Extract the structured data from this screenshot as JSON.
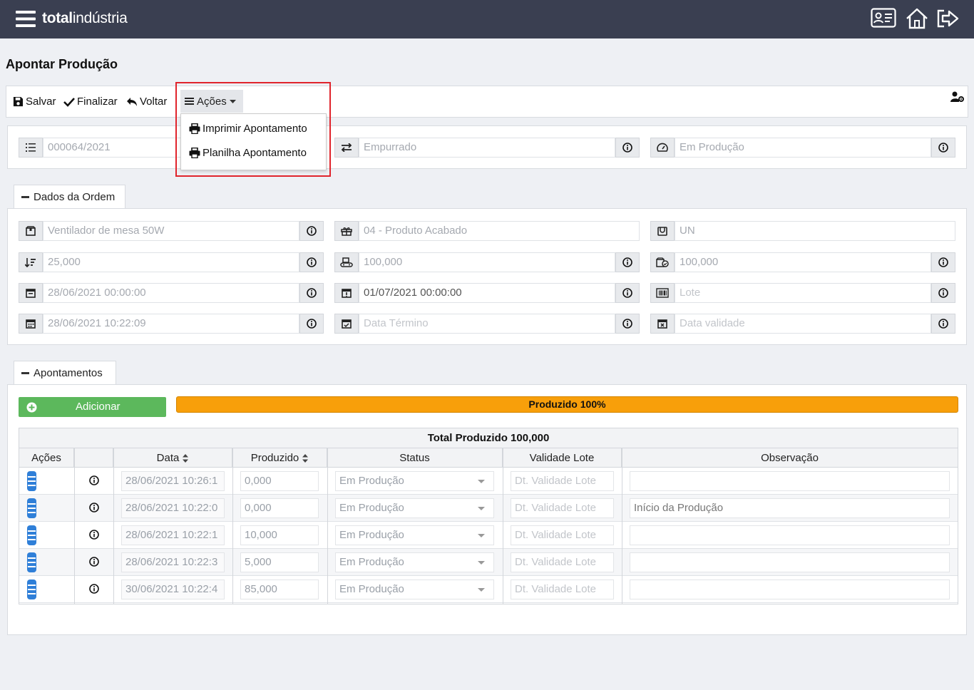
{
  "app": {
    "brand_bold": "total",
    "brand_light": "indústria"
  },
  "page": {
    "title": "Apontar Produção"
  },
  "toolbar": {
    "save": "Salvar",
    "finish": "Finalizar",
    "back": "Voltar",
    "actions": "Ações"
  },
  "actions_menu": {
    "items": [
      "Imprimir Apontamento",
      "Planilha Apontamento"
    ]
  },
  "header_fields": {
    "order_number": "000064/2021",
    "type": "Empurrado",
    "status": "Em Produção"
  },
  "order_section": {
    "title": "Dados da Ordem",
    "product": "Ventilador de mesa 50W",
    "product_type": "04 - Produto Acabado",
    "unit": "UN",
    "qty_min": "25,000",
    "qty_produce": "100,000",
    "qty_produced": "100,000",
    "date_start_planned": "28/06/2021 00:00:00",
    "date_end_planned": "01/07/2021 00:00:00",
    "lot_placeholder": "Lote",
    "date_start_real": "28/06/2021 10:22:09",
    "date_end_placeholder": "Data Término",
    "validity_placeholder": "Data validade"
  },
  "records_section": {
    "title": "Apontamentos",
    "add_button": "Adicionar",
    "progress_label": "Produzido 100%",
    "progress_value": 100,
    "table_title": "Total Produzido 100,000",
    "columns": [
      "Ações",
      "",
      "Data",
      "Produzido",
      "Status",
      "Validade Lote",
      "Observação"
    ],
    "rows": [
      {
        "date": "28/06/2021 10:26:1",
        "produced": "0,000",
        "status": "Em Produção",
        "validity": "Dt. Validade Lote",
        "note": ""
      },
      {
        "date": "28/06/2021 10:22:0",
        "produced": "0,000",
        "status": "Em Produção",
        "validity": "Dt. Validade Lote",
        "note": "Início da Produção"
      },
      {
        "date": "28/06/2021 10:22:1",
        "produced": "10,000",
        "status": "Em Produção",
        "validity": "Dt. Validade Lote",
        "note": ""
      },
      {
        "date": "28/06/2021 10:22:3",
        "produced": "5,000",
        "status": "Em Produção",
        "validity": "Dt. Validade Lote",
        "note": ""
      },
      {
        "date": "30/06/2021 10:22:4",
        "produced": "85,000",
        "status": "Em Produção",
        "validity": "Dt. Validade Lote",
        "note": ""
      }
    ]
  },
  "colors": {
    "topbar": "#3a3f51",
    "add_button": "#5cb85c",
    "progress": "#f89f0a",
    "highlight": "#e0242c",
    "action_button": "#2f7fd8"
  }
}
